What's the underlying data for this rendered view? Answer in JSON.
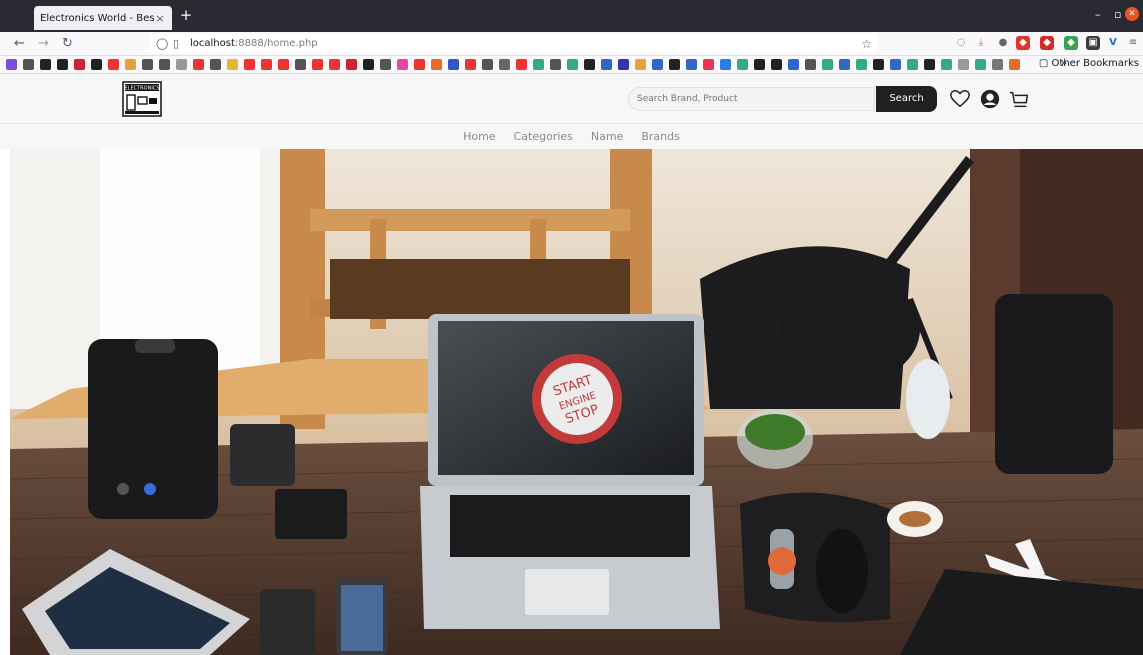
{
  "browser": {
    "tab_title": "Electronics World - Best Onl",
    "tab_close": "×",
    "new_tab": "+",
    "url_host": "localhost",
    "url_path": ":8888/home.php",
    "bookmarks_more": "»",
    "other_bookmarks": "Other Bookmarks"
  },
  "site": {
    "logo_text": "ELECTRONICS",
    "search_placeholder": "Search Brand, Product",
    "search_button": "Search",
    "nav": [
      "Home",
      "Categories",
      "Name",
      "Brands"
    ]
  },
  "hero": {
    "screen_text": [
      "START",
      "ENGINE",
      "STOP"
    ]
  },
  "colors": {
    "tab_strip": "#2b2a33",
    "search_button": "#212121",
    "header_bg": "#f7f7f7"
  }
}
